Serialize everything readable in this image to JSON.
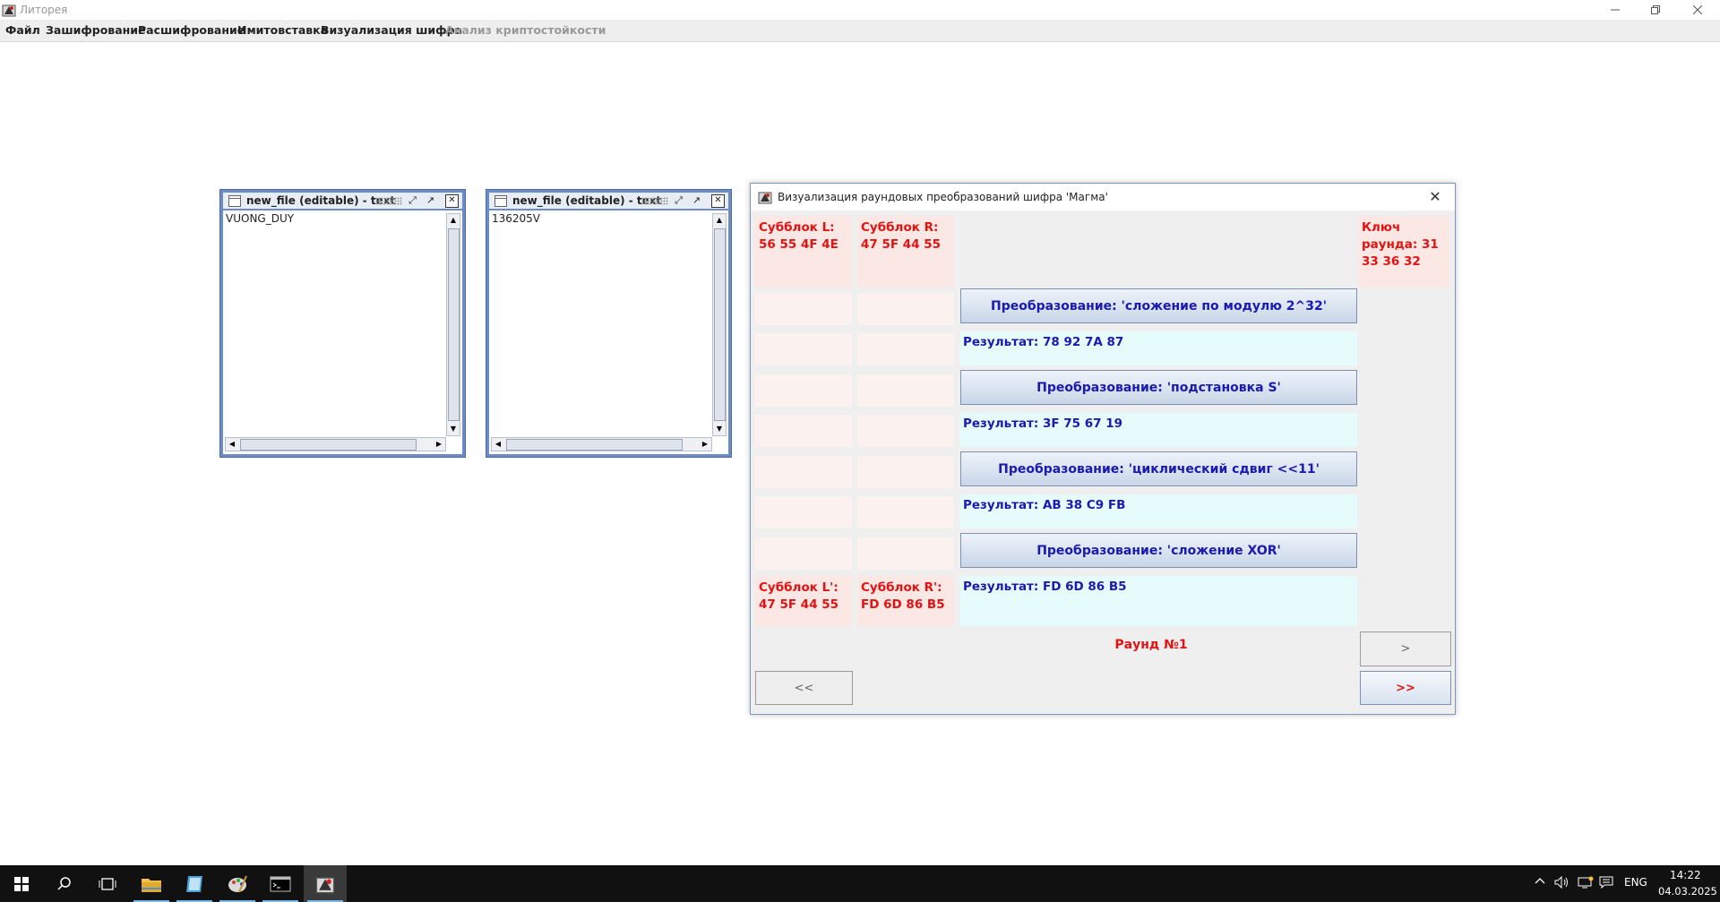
{
  "window": {
    "title": "Литорея"
  },
  "menu": [
    {
      "label": "Файл",
      "enabled": true
    },
    {
      "label": "Зашифрование",
      "enabled": true
    },
    {
      "label": "Расшифрование",
      "enabled": true
    },
    {
      "label": "Имитовставка",
      "enabled": true
    },
    {
      "label": "Визуализация шифра",
      "enabled": true
    },
    {
      "label": "Анализ криптостойкости",
      "enabled": false
    }
  ],
  "frames": [
    {
      "title": "new_file (editable) - text",
      "content": "VUONG_DUY"
    },
    {
      "title": "new_file (editable) - text",
      "content": "136205V"
    }
  ],
  "dialog": {
    "title": "Визуализация раундовых преобразований шифра 'Магма'",
    "subblock_l": "Субблок L: 56 55 4F 4E",
    "subblock_r": "Субблок R: 47 5F 44 55",
    "round_key": "Ключ раунда: 31 33 36 32",
    "steps": [
      {
        "operation": "Преобразование: 'сложение по модулю 2^32'",
        "result": "Результат: 78 92 7A 87"
      },
      {
        "operation": "Преобразование: 'подстановка S'",
        "result": "Результат: 3F 75 67 19"
      },
      {
        "operation": "Преобразование: 'циклический сдвиг <<11'",
        "result": "Результат: AB 38 C9 FB"
      },
      {
        "operation": "Преобразование: 'сложение XOR'",
        "result": "Результат: FD 6D 86 B5"
      }
    ],
    "subblock_l_out": "Субблок L': 47 5F 44 55",
    "subblock_r_out": "Субблок R': FD 6D 86 B5",
    "round_label": "Раунд №1",
    "btn_prev_all": "<<",
    "btn_next": ">",
    "btn_next_all": ">>"
  },
  "taskbar": {
    "language": "ENG",
    "time": "14:22",
    "date": "04.03.2025"
  }
}
